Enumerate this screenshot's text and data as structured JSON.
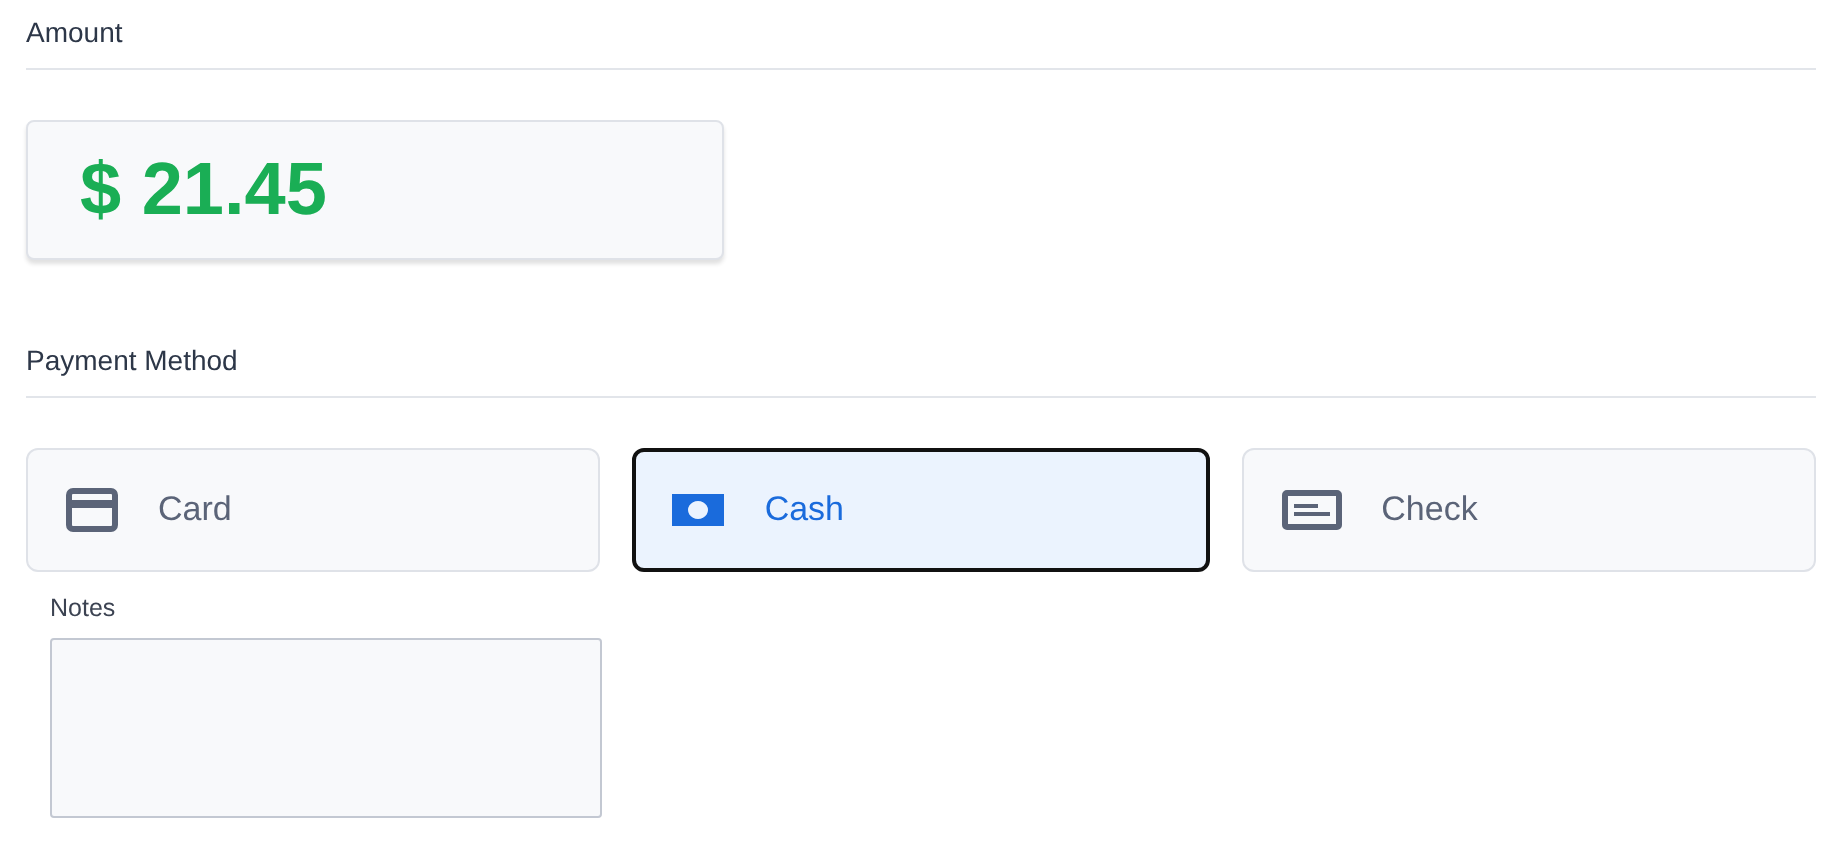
{
  "amount_section": {
    "heading": "Amount",
    "amount": "$ 21.45"
  },
  "payment_section": {
    "heading": "Payment Method",
    "methods": [
      {
        "kind": "card",
        "label": "Card",
        "selected": false
      },
      {
        "kind": "cash",
        "label": "Cash",
        "selected": true
      },
      {
        "kind": "check",
        "label": "Check",
        "selected": false
      }
    ]
  },
  "notes": {
    "label": "Notes"
  }
}
